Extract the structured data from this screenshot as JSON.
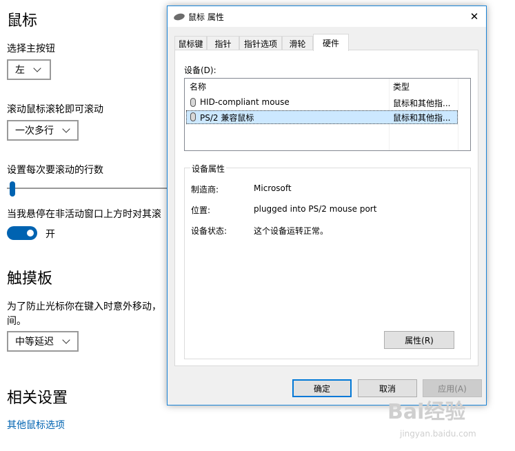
{
  "settings": {
    "title": "鼠标",
    "primary_button_label": "选择主按钮",
    "primary_button_value": "左",
    "scroll_label": "滚动鼠标滚轮即可滚动",
    "scroll_value": "一次多行",
    "lines_label": "设置每次要滚动的行数",
    "inactive_label": "当我悬停在非活动窗口上方时对其滚",
    "inactive_toggle_text": "开",
    "touchpad_title": "触摸板",
    "touchpad_desc_line1": "为了防止光标你在键入时意外移动，",
    "touchpad_desc_line2": "间。",
    "touchpad_value": "中等延迟",
    "related_title": "相关设置",
    "other_mouse_link": "其他鼠标选项"
  },
  "dialog": {
    "title": "鼠标 属性",
    "close_glyph": "✕",
    "tabs": [
      "鼠标键",
      "指针",
      "指针选项",
      "滑轮",
      "硬件"
    ],
    "active_tab": 4,
    "devices_label": "设备(D):",
    "columns": {
      "name": "名称",
      "type": "类型"
    },
    "devices": [
      {
        "name": "HID-compliant mouse",
        "type": "鼠标和其他指..."
      },
      {
        "name": "PS/2 兼容鼠标",
        "type": "鼠标和其他指..."
      }
    ],
    "selected_device": 1,
    "group_title": "设备属性",
    "properties": [
      {
        "key": "制造商:",
        "value": "Microsoft"
      },
      {
        "key": "位置:",
        "value": "plugged into PS/2 mouse port"
      },
      {
        "key": "设备状态:",
        "value": "这个设备运转正常。"
      }
    ],
    "properties_button": "属性(R)",
    "ok_button": "确定",
    "cancel_button": "取消",
    "apply_button": "应用(A)"
  },
  "watermark": {
    "main": "Bai经验",
    "sub": "jingyan.baidu.com"
  },
  "colors": {
    "accent": "#0063b1",
    "dialog_border": "#1883d7",
    "selection": "#cce8ff"
  }
}
